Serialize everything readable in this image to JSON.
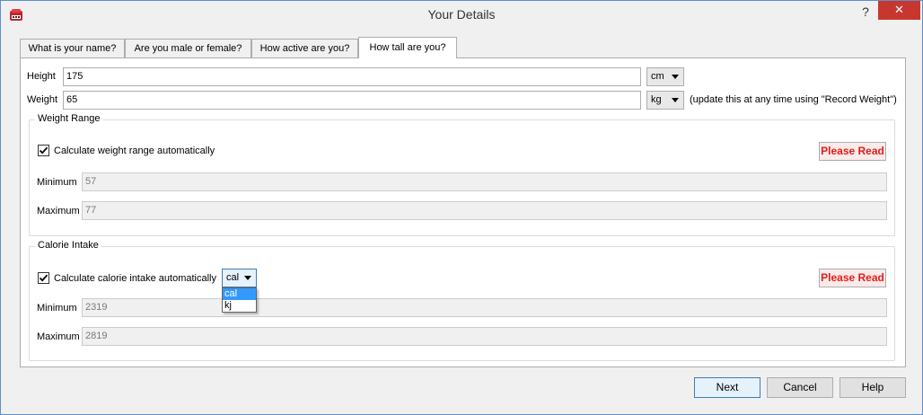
{
  "window": {
    "title": "Your Details",
    "help_glyph": "?",
    "close_glyph": "✕",
    "app_icon": "calculator-icon"
  },
  "tabs": [
    {
      "label": "What is your name?",
      "active": false
    },
    {
      "label": "Are you male or female?",
      "active": false
    },
    {
      "label": "How active are you?",
      "active": false
    },
    {
      "label": "How tall are you?",
      "active": true
    }
  ],
  "height": {
    "label": "Height",
    "value": "175",
    "unit": "cm"
  },
  "weight": {
    "label": "Weight",
    "value": "65",
    "unit": "kg",
    "note": "(update this at any time using \"Record Weight\")"
  },
  "weight_range": {
    "title": "Weight Range",
    "auto_label": "Calculate weight range automatically",
    "auto_checked": true,
    "please_read": "Please Read",
    "minimum_label": "Minimum",
    "minimum_value": "57",
    "maximum_label": "Maximum",
    "maximum_value": "77"
  },
  "calorie_intake": {
    "title": "Calorie Intake",
    "auto_label": "Calculate calorie intake automatically",
    "auto_checked": true,
    "unit_selected": "cal",
    "unit_options": [
      "cal",
      "kj"
    ],
    "please_read": "Please Read",
    "minimum_label": "Minimum",
    "minimum_value": "2319",
    "maximum_label": "Maximum",
    "maximum_value": "2819"
  },
  "buttons": {
    "next": "Next",
    "cancel": "Cancel",
    "help": "Help"
  },
  "colors": {
    "accent": "#3399ff",
    "close": "#c7372f",
    "please_read": "#e0201a"
  }
}
